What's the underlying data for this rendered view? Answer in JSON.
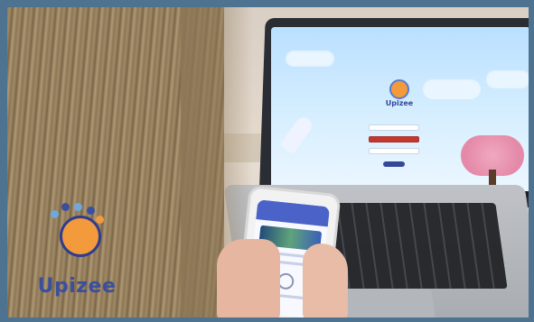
{
  "screen": {
    "app_name": "Upizee"
  },
  "brand": {
    "name": "Upizee",
    "primary_color": "#3b4f9f",
    "accent_color": "#f29a3c"
  },
  "icons": {
    "rocket": "rocket-icon",
    "tree": "cherry-blossom-tree-icon",
    "clock": "clock-icon"
  }
}
